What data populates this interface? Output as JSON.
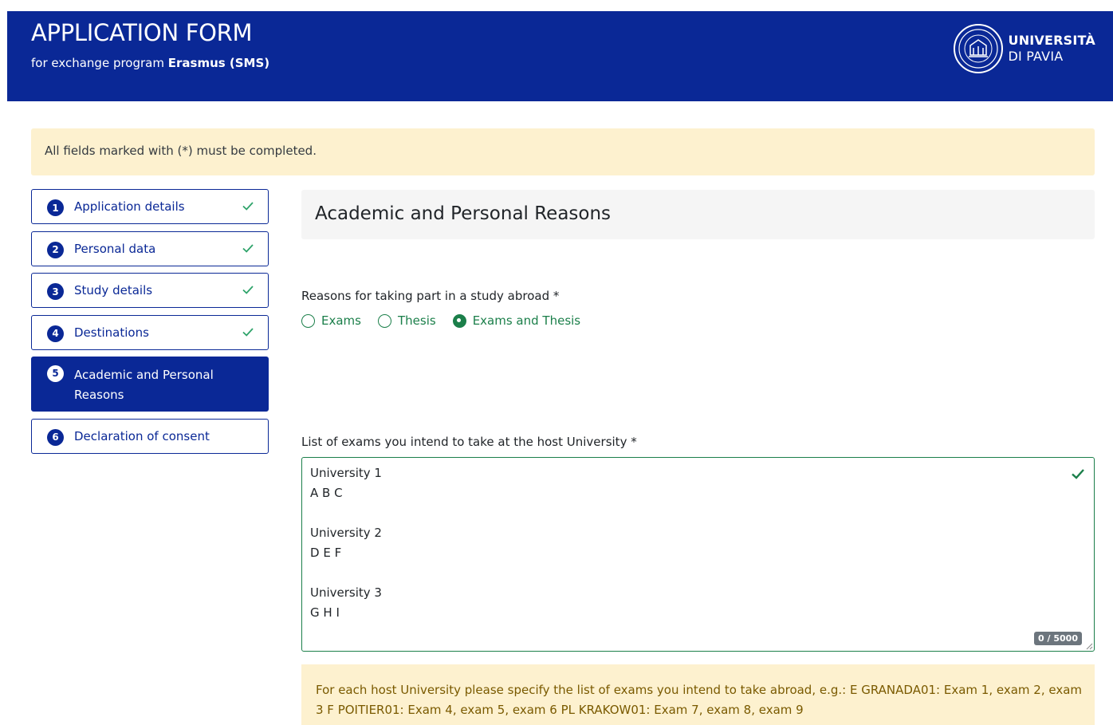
{
  "header": {
    "title": "APPLICATION FORM",
    "subtitle_prefix": "for exchange program ",
    "subtitle_program": "Erasmus (SMS)",
    "logo_line1": "UNIVERSITÀ",
    "logo_line2": "DI PAVIA",
    "background_color": "#0a2896"
  },
  "notice": {
    "text": "All fields marked with (*) must be completed."
  },
  "steps": [
    {
      "number": "1",
      "label": "Application details",
      "completed": true
    },
    {
      "number": "2",
      "label": "Personal data",
      "completed": true
    },
    {
      "number": "3",
      "label": "Study details",
      "completed": true
    },
    {
      "number": "4",
      "label": "Destinations",
      "completed": true
    },
    {
      "number": "5",
      "label": "Academic and Personal Reasons",
      "active": true
    },
    {
      "number": "6",
      "label": "Declaration of consent",
      "completed": false
    }
  ],
  "section": {
    "title": "Academic and Personal Reasons"
  },
  "reasons": {
    "label": "Reasons for taking part in a study abroad *",
    "options": [
      "Exams",
      "Thesis",
      "Exams and Thesis"
    ],
    "selected": "Exams and Thesis"
  },
  "exams": {
    "label": "List of exams you intend to take at the host University *",
    "value": "University 1\nA B C\n\nUniversity 2\nD E F\n\nUniversity 3\nG H I",
    "counter": "0 / 5000"
  },
  "hint": {
    "text": "For each host University please specify the list of exams you intend to take abroad, e.g.: E GRANADA01: Exam 1, exam 2, exam 3 F POITIER01: Exam 4, exam 5, exam 6 PL KRAKOW01: Exam 7, exam 8, exam 9"
  },
  "colors": {
    "primary": "#0a2896",
    "success": "#1b7f4a",
    "warning_bg": "#fdf1cf"
  }
}
